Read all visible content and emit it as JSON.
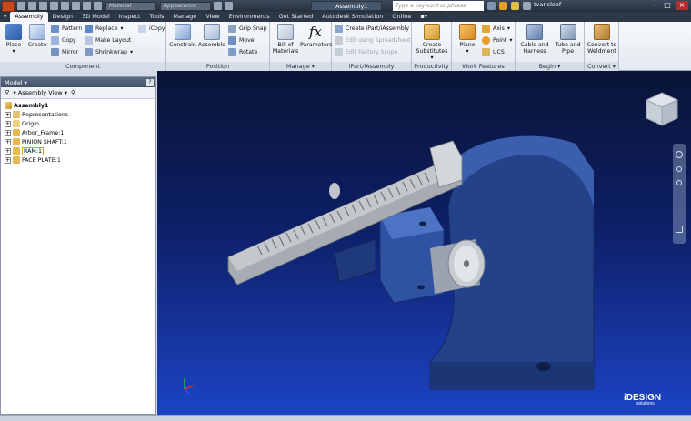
{
  "quick_access": {
    "material_placeholder": "Material",
    "appearance_placeholder": "Appearance",
    "document_title": "Assembly1",
    "search_placeholder": "Type a keyword or phrase",
    "user_name": "tvancleaf"
  },
  "tabs": [
    "Assembly",
    "Design",
    "3D Model",
    "Inspect",
    "Tools",
    "Manage",
    "View",
    "Environments",
    "Get Started",
    "Autodesk Simulation",
    "Online"
  ],
  "active_tab": "Assembly",
  "ribbon": {
    "component": {
      "title": "Component",
      "place": "Place",
      "create": "Create",
      "pattern": "Pattern",
      "copy": "Copy",
      "mirror": "Mirror",
      "replace": "Replace",
      "make_layout": "Make Layout",
      "shrinkwrap": "Shrinkwrap",
      "icopy": "iCopy"
    },
    "position": {
      "title": "Position",
      "constrain": "Constrain",
      "assemble": "Assemble",
      "grip_snap": "Grip Snap",
      "move": "Move",
      "rotate": "Rotate"
    },
    "manage": {
      "title": "Manage",
      "bom_line1": "Bill of",
      "bom_line2": "Materials",
      "parameters": "Parameters"
    },
    "ipart": {
      "title": "iPart/iAssembly",
      "create": "Create iPart/iAssembly",
      "edit_spreadsheet": "Edit using Spreadsheet",
      "edit_factory": "Edit Factory Scope"
    },
    "productivity": {
      "title": "Productivity",
      "create_line1": "Create",
      "create_line2": "Substitutes"
    },
    "work_features": {
      "title": "Work Features",
      "plane": "Plane",
      "axis": "Axis",
      "point": "Point",
      "ucs": "UCS"
    },
    "begin": {
      "title": "Begin",
      "cable_line1": "Cable and",
      "cable_line2": "Harness",
      "tube_line1": "Tube and",
      "tube_line2": "Pipe"
    },
    "convert": {
      "title": "Convert",
      "line1": "Convert to",
      "line2": "Weldment"
    }
  },
  "browser": {
    "title": "Model",
    "help": "?",
    "view_label": "Assembly View",
    "tree": [
      {
        "label": "Assembly1",
        "root": true
      },
      {
        "label": "Representations"
      },
      {
        "label": "Origin"
      },
      {
        "label": "Arbor_Frame:1"
      },
      {
        "label": "PINION SHAFT:1"
      },
      {
        "label": "RAM:1",
        "selected": true
      },
      {
        "label": "FACE PLATE:1"
      }
    ]
  },
  "viewport": {
    "brand_main": "iDESIGN",
    "brand_sub": "solutions"
  },
  "colors": {
    "viewport_top": "#0a1436",
    "viewport_bottom": "#1c43c4",
    "frame_blue": "#2a4a94",
    "ram_gray": "#9a9ea6"
  }
}
